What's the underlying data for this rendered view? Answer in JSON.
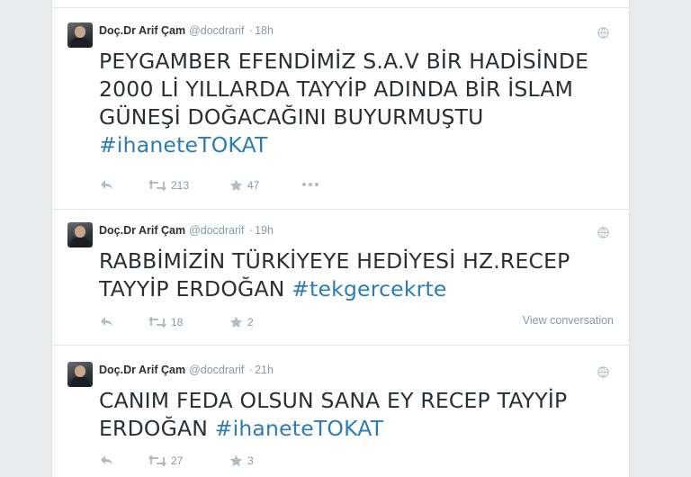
{
  "colors": {
    "hashtag": "#2b7bb9",
    "muted": "#8899a6",
    "text": "#292f33"
  },
  "tweets": [
    {
      "name": "Doç.Dr Arif Çam",
      "handle": "@docdrarif",
      "dot": "·",
      "time": "18h",
      "text": "PEYGAMBER EFENDİMİZ S.A.V BİR HADİSİNDE 2000 Lİ YILLARDA TAYYİP ADINDA BİR İSLAM GÜNEŞİ DOĞACAĞINI BUYURMUŞTU ",
      "hashtag": "#ihaneteTOKAT",
      "retweets": "213",
      "favorites": "47",
      "icons": [
        "reply-icon",
        "retweet-icon",
        "favorite-icon",
        "more-icon",
        "globe-icon"
      ]
    },
    {
      "name": "Doç.Dr Arif Çam",
      "handle": "@docdrarif",
      "dot": "·",
      "time": "19h",
      "text": "RABBİMİZİN TÜRKİYEYE HEDİYESİ HZ.RECEP TAYYİP ERDOĞAN ",
      "hashtag": "#tekgercekrte",
      "retweets": "18",
      "favorites": "2",
      "view_conversation": "View conversation",
      "icons": [
        "reply-icon",
        "retweet-icon",
        "favorite-icon",
        "more-icon",
        "globe-icon"
      ]
    },
    {
      "name": "Doç.Dr Arif Çam",
      "handle": "@docdrarif",
      "dot": "·",
      "time": "21h",
      "text": "CANIM FEDA OLSUN SANA EY RECEP TAYYİP ERDOĞAN ",
      "hashtag": "#ihaneteTOKAT",
      "retweets": "27",
      "favorites": "3",
      "icons": [
        "reply-icon",
        "retweet-icon",
        "favorite-icon",
        "more-icon",
        "globe-icon"
      ]
    }
  ]
}
